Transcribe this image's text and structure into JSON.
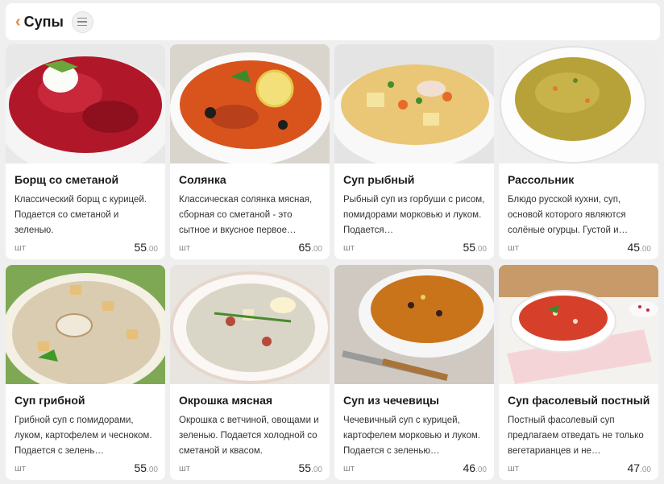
{
  "header": {
    "back_icon": "chevron-left-icon",
    "title": "Супы",
    "menu_icon": "hamburger-icon"
  },
  "colors": {
    "accent": "#e08a3c",
    "background": "#efefef",
    "card": "#ffffff"
  },
  "items": [
    {
      "name": "Борщ со сметаной",
      "desc": "Классический борщ с курицей. Подается со сметаной и зеленью.",
      "unit": "шт",
      "price": "55",
      "cents": ".00"
    },
    {
      "name": "Солянка",
      "desc": "Классическая солянка мясная, сборная со сметаной - это сытное и вкусное первое…",
      "unit": "шт",
      "price": "65",
      "cents": ".00"
    },
    {
      "name": "Суп рыбный",
      "desc": "Рыбный суп из горбуши с рисом, помидорами морковью и луком. Подается…",
      "unit": "шт",
      "price": "55",
      "cents": ".00"
    },
    {
      "name": "Рассольник",
      "desc": "Блюдо русской кухни, суп, основой которого являются солёные огурцы. Густой и…",
      "unit": "шт",
      "price": "45",
      "cents": ".00"
    },
    {
      "name": "Суп грибной",
      "desc": "Грибной суп с помидорами, луком, картофелем и чесноком. Подается с зелень…",
      "unit": "шт",
      "price": "55",
      "cents": ".00"
    },
    {
      "name": "Окрошка мясная",
      "desc": "Окрошка с ветчиной, овощами и зеленью. Подается холодной со сметаной и квасом.",
      "unit": "шт",
      "price": "55",
      "cents": ".00"
    },
    {
      "name": "Суп из чечевицы",
      "desc": "Чечевичный суп с курицей, картофелем морковью и луком. Подается с зеленью…",
      "unit": "шт",
      "price": "46",
      "cents": ".00"
    },
    {
      "name": "Суп фасолевый постный",
      "desc": "Постный фасолевый суп предлагаем отведать не только вегетарианцев и не…",
      "unit": "шт",
      "price": "47",
      "cents": ".00"
    }
  ]
}
